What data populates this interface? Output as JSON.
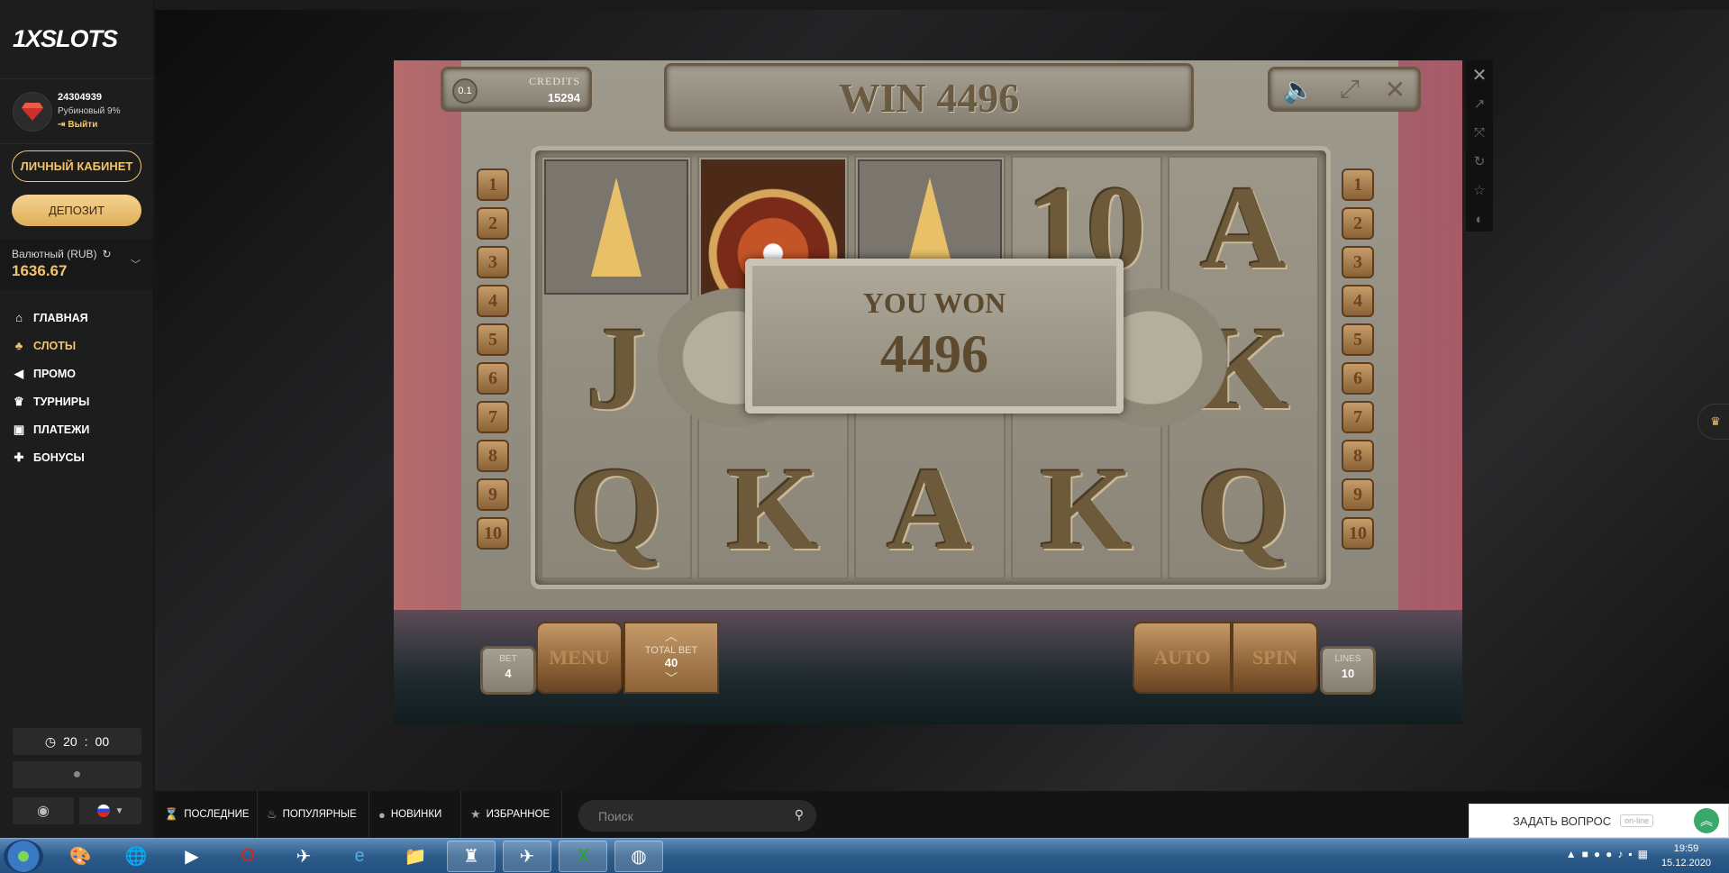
{
  "sidebar": {
    "logo": "1XSLOTS",
    "user": {
      "id": "24304939",
      "level": "Рубиновый 9%",
      "logout": "Выйти"
    },
    "cabinet_label": "ЛИЧНЫЙ КАБИНЕТ",
    "deposit_label": "ДЕПОЗИТ",
    "balance": {
      "currency": "Валютный (RUB)",
      "amount": "1636.67"
    },
    "nav": [
      {
        "label": "ГЛАВНАЯ",
        "icon": "home-icon"
      },
      {
        "label": "СЛОТЫ",
        "icon": "cherry-icon",
        "active": true
      },
      {
        "label": "ПРОМО",
        "icon": "megaphone-icon"
      },
      {
        "label": "ТУРНИРЫ",
        "icon": "trophy-icon"
      },
      {
        "label": "ПЛАТЕЖИ",
        "icon": "wallet-icon"
      },
      {
        "label": "БОНУСЫ",
        "icon": "gift-icon"
      }
    ],
    "clock": {
      "h": "20",
      "sep": ":",
      "m": "00"
    }
  },
  "game": {
    "bet_unit": "0.1",
    "credits_label": "CREDITS",
    "credits_value": "15294",
    "win_text": "WIN 4496",
    "popup": {
      "title": "YOU WON",
      "amount": "4496"
    },
    "reels": [
      [
        "spear",
        "J",
        "Q"
      ],
      [
        "sun",
        "",
        "K"
      ],
      [
        "spear",
        "",
        "A"
      ],
      [
        "10",
        "",
        "K"
      ],
      [
        "A",
        "K",
        "Q"
      ]
    ],
    "line_numbers": [
      "1",
      "2",
      "3",
      "4",
      "5",
      "6",
      "7",
      "8",
      "9",
      "10"
    ],
    "bet": {
      "label": "BET",
      "value": "4"
    },
    "menu_label": "MENU",
    "total_bet": {
      "label": "TOTAL BET",
      "value": "40"
    },
    "auto_label": "AUTO",
    "spin_label": "SPIN",
    "lines": {
      "label": "LINES",
      "value": "10"
    }
  },
  "bottom_tabs": [
    {
      "label": "ПОСЛЕДНИЕ",
      "icon": "hourglass-icon"
    },
    {
      "label": "ПОПУЛЯРНЫЕ",
      "icon": "flame-icon"
    },
    {
      "label": "НОВИНКИ",
      "icon": "chat-icon"
    },
    {
      "label": "ИЗБРАННОЕ",
      "icon": "star-icon"
    }
  ],
  "search": {
    "placeholder": "Поиск"
  },
  "chat": {
    "label": "ЗАДАТЬ ВОПРОС",
    "status": "on-line"
  },
  "taskbar": {
    "time": "19:59",
    "date": "15.12.2020"
  },
  "colors": {
    "accent": "#f2c46d",
    "sidebar": "#1d1d1e"
  }
}
